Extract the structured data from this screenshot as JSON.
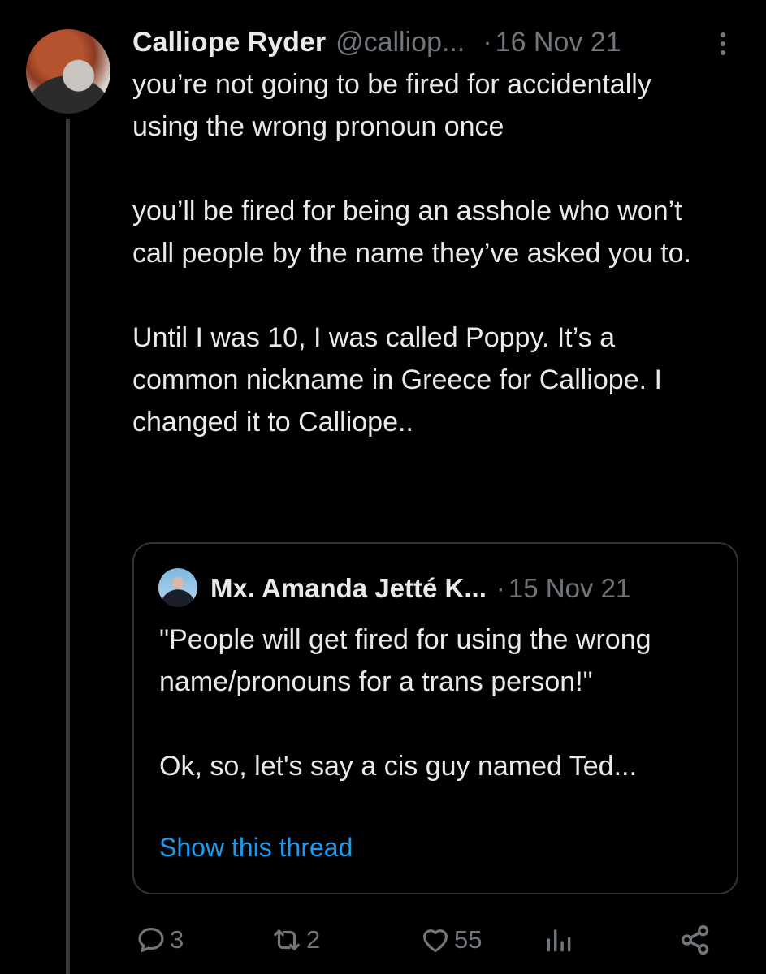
{
  "tweet": {
    "author_name": "Calliope Ryder",
    "author_handle": "@calliop...",
    "separator": "·",
    "date": "16 Nov 21",
    "body_paragraphs": [
      "you’re not going to be fired for accidentally using the wrong pronoun once",
      "you’ll be fired for being an asshole who won’t call people by the name they’ve asked you to.",
      "Until I was 10, I was called Poppy. It’s a common nickname in Greece for Calliope. I changed it to Calliope.."
    ]
  },
  "quoted_tweet": {
    "author_name": "Mx. Amanda Jetté K...",
    "separator": "·",
    "date": "15 Nov 21",
    "body_paragraphs": [
      "\"People will get fired for using the wrong name/pronouns for a trans person!\"",
      "Ok, so, let's say a cis guy named Ted..."
    ],
    "show_thread_label": "Show this thread"
  },
  "actions": {
    "replies": "3",
    "retweets": "2",
    "likes": "55",
    "icons": [
      "reply-icon",
      "retweet-icon",
      "like-icon",
      "analytics-icon",
      "share-icon"
    ]
  },
  "colors": {
    "background": "#000000",
    "text": "#e7e9ea",
    "secondary": "#71767b",
    "link": "#1d9bf0",
    "border": "#2f3336"
  }
}
